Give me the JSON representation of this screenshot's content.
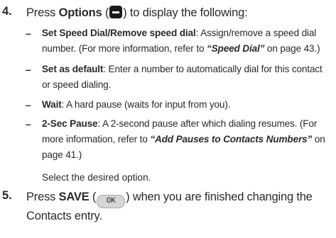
{
  "step4": {
    "number": "4.",
    "press": "Press ",
    "key_label": "Options",
    "open_paren": " (",
    "close_paren": ") to display the following:"
  },
  "bullets": [
    {
      "term": "Set Speed Dial/Remove speed dial",
      "pre": ": Assign/remove a speed dial number. (For more information, refer to ",
      "xref": "“Speed Dial”",
      "post": "  on page 43.)"
    },
    {
      "term": "Set as default",
      "pre": ": Enter a number to automatically dial for this contact or speed dialing.",
      "xref": "",
      "post": ""
    },
    {
      "term": "Wait",
      "pre": ": A hard pause (waits for input from you).",
      "xref": "",
      "post": ""
    },
    {
      "term": "2-Sec Pause",
      "pre": ": A 2-second pause after which dialing resumes. (For more information, refer to ",
      "xref": "“Add Pauses to Contacts Numbers”",
      "post": " on page 41.)"
    }
  ],
  "select_text": "Select the desired option.",
  "step5": {
    "number": "5.",
    "press": "Press ",
    "key_label": "SAVE",
    "open_paren": " (",
    "ok_key_text": "OK",
    "close_paren": ") when you are finished changing the Contacts entry."
  },
  "icons": {
    "options_key": "soft-key-minus-icon",
    "ok_key": "ok-key-icon"
  }
}
